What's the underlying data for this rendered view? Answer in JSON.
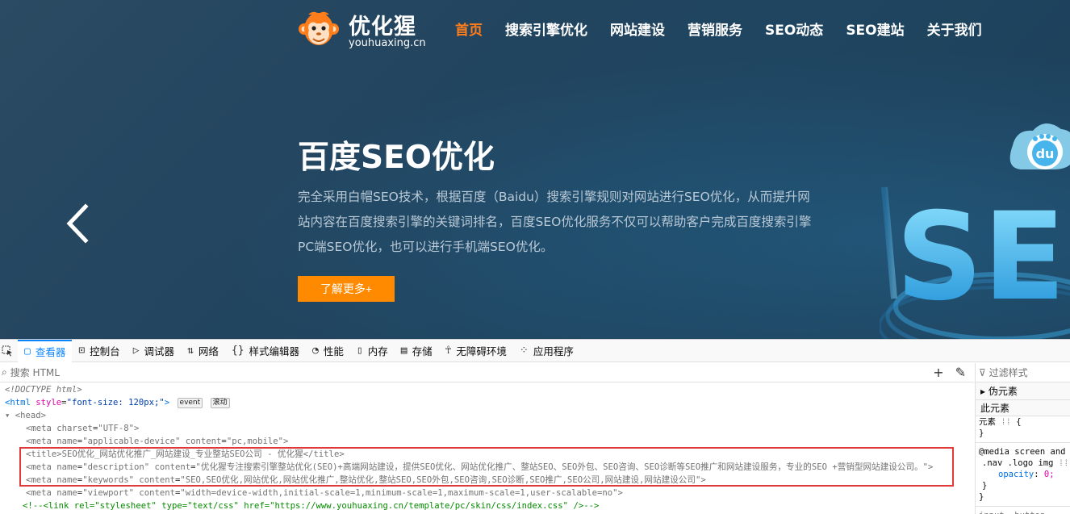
{
  "site": {
    "logo": {
      "brand": "优化猩",
      "domain": "youhuaxing.cn"
    },
    "nav": [
      {
        "label": "首页",
        "active": true
      },
      {
        "label": "搜索引擎优化",
        "active": false
      },
      {
        "label": "网站建设",
        "active": false
      },
      {
        "label": "营销服务",
        "active": false
      },
      {
        "label": "SEO动态",
        "active": false
      },
      {
        "label": "SEO建站",
        "active": false
      },
      {
        "label": "关于我们",
        "active": false
      }
    ],
    "hero": {
      "title": "百度SEO优化",
      "description": "完全采用白帽SEO技术，根据百度（Baidu）搜索引擎规则对网站进行SEO优化，从而提升网站内容在百度搜索引擎的关键词排名，百度SEO优化服务不仅可以帮助客户完成百度搜索引擎PC端SEO优化，也可以进行手机端SEO优化。",
      "button": "了解更多+",
      "art_text": "SE",
      "art_badge": "du"
    },
    "colors": {
      "accent": "#ff8a00",
      "nav_active": "#ff7d1a",
      "hero_bg": "#23455f"
    }
  },
  "devtools": {
    "tabs": [
      {
        "label": "查看器",
        "icon": "inspector-icon",
        "glyph": "▢",
        "active": true
      },
      {
        "label": "控制台",
        "icon": "console-icon",
        "glyph": "⊡",
        "active": false
      },
      {
        "label": "调试器",
        "icon": "debugger-icon",
        "glyph": "▷",
        "active": false
      },
      {
        "label": "网络",
        "icon": "network-icon",
        "glyph": "⇅",
        "active": false
      },
      {
        "label": "样式编辑器",
        "icon": "style-editor-icon",
        "glyph": "{}",
        "active": false
      },
      {
        "label": "性能",
        "icon": "performance-icon",
        "glyph": "◔",
        "active": false
      },
      {
        "label": "内存",
        "icon": "memory-icon",
        "glyph": "▯",
        "active": false
      },
      {
        "label": "存储",
        "icon": "storage-icon",
        "glyph": "▤",
        "active": false
      },
      {
        "label": "无障碍环境",
        "icon": "accessibility-icon",
        "glyph": "☥",
        "active": false
      },
      {
        "label": "应用程序",
        "icon": "application-icon",
        "glyph": "⁘",
        "active": false
      }
    ],
    "search_placeholder": "搜索 HTML",
    "markup": {
      "doctype": "<!DOCTYPE html>",
      "html_open": "<html",
      "html_style_attr": "style",
      "html_style_val": "\"font-size: 120px;\"",
      "html_close_bracket": ">",
      "badge_event": "event",
      "badge_scroll": "滚动",
      "head_open": "<head>",
      "meta_charset": {
        "tag": "<meta",
        "attr": "charset",
        "val": "\"UTF-8\"",
        "end": ">"
      },
      "meta_device": {
        "tag": "<meta",
        "attr1": "name",
        "val1": "\"applicable-device\"",
        "attr2": "content",
        "val2": "\"pc,mobile\"",
        "end": ">"
      },
      "title_open": "<title>",
      "title_text": "SEO优化_网站优化推广_网站建设_专业整站SEO公司 - 优化猩",
      "title_close": "</title>",
      "meta_description": {
        "tag": "<meta",
        "attr1": "name",
        "val1": "\"description\"",
        "attr2": "content",
        "val2": "\"优化猩专注搜索引擎整站优化(SEO)+高端网站建设，提供SEO优化、网站优化推广、整站SEO、SEO外包、SEO咨询、SEO诊断等SEO推广和网站建设服务，专业的SEO +营销型网站建设公司。\"",
        "end": ">"
      },
      "meta_keywords": {
        "tag": "<meta",
        "attr1": "name",
        "val1": "\"keywords\"",
        "attr2": "content",
        "val2": "\"SEO,SEO优化,网站优化,网站优化推广,整站优化,整站SEO,SEO外包,SEO咨询,SEO诊断,SEO推广,SEO公司,网站建设,网站建设公司\"",
        "end": ">"
      },
      "meta_viewport": {
        "tag": "<meta",
        "attr1": "name",
        "val1": "\"viewport\"",
        "attr2": "content",
        "val2": "\"width=device-width,initial-scale=1,minimum-scale=1,maximum-scale=1,user-scalable=no\"",
        "end": ">"
      },
      "comment": "<!--<link rel=\"stylesheet\" type=\"text/css\" href=\"https://www.youhuaxing.cn/template/pc/skin/css/index.css\" />-->"
    },
    "rules": {
      "filter_placeholder": "过滤样式",
      "pseudo_label": "伪元素",
      "this_element_label": "此元素",
      "element_rule_selector": "元素",
      "element_rule_open": "{",
      "element_rule_close": "}",
      "media_query": "@media screen and (",
      "media_selector": ".nav .logo img",
      "prop_name": "opacity",
      "prop_value": "0;",
      "inner_close": "}",
      "outer_close": "}",
      "bottom_hint": "input, button, text"
    }
  }
}
